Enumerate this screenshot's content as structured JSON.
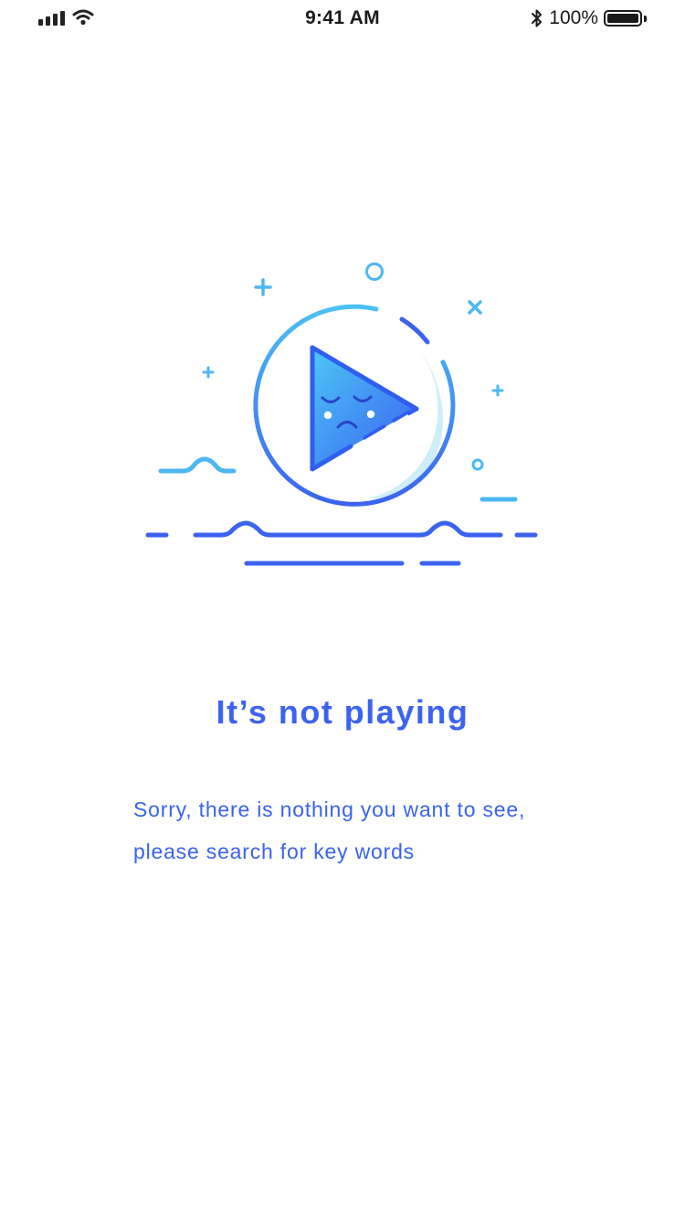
{
  "status_bar": {
    "time": "9:41 AM",
    "battery_percent": "100%",
    "icons": [
      "signal-icon",
      "wifi-icon",
      "bluetooth-icon",
      "battery-icon"
    ]
  },
  "empty_state": {
    "title": "It’s not playing",
    "message": "Sorry, there is nothing you want to see, please search for key words",
    "illustration": "sad-play-button-icon"
  },
  "colors": {
    "primary_blue": "#3b63f0",
    "light_blue": "#4cb8f0",
    "pale_blue": "#cdeefa"
  }
}
